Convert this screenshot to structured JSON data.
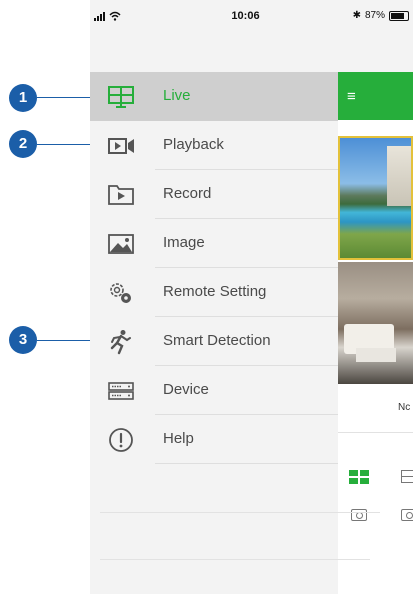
{
  "status_bar": {
    "time": "10:06",
    "battery": "87%"
  },
  "drawer": {
    "items": [
      {
        "label": "Live",
        "icon": "live-view-icon",
        "active": true
      },
      {
        "label": "Playback",
        "icon": "playback-icon"
      },
      {
        "label": "Record",
        "icon": "record-folder-icon"
      },
      {
        "label": "Image",
        "icon": "image-icon"
      },
      {
        "label": "Remote Setting",
        "icon": "remote-setting-gears-icon"
      },
      {
        "label": "Smart Detection",
        "icon": "running-person-icon"
      },
      {
        "label": "Device",
        "icon": "device-dvr-icon"
      },
      {
        "label": "Help",
        "icon": "help-exclamation-icon"
      }
    ]
  },
  "callouts": [
    "1",
    "2",
    "3"
  ],
  "main": {
    "camera_label": "Nc"
  },
  "colors": {
    "accent": "#26ae3b",
    "callout": "#1b5ea8",
    "active_bg": "#cfcfcf"
  }
}
